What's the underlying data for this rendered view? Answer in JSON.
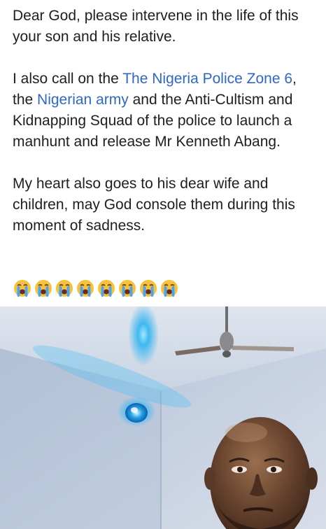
{
  "post": {
    "p1": "Dear God, please intervene in the life of this your son and his relative.",
    "p2_prefix": "I also call on the ",
    "p2_link1": "The Nigeria Police Zone 6",
    "p2_mid1": ", the ",
    "p2_link2": "Nigerian army",
    "p2_suffix": " and the Anti-Cultism and Kidnapping Squad of the police to launch a manhunt and release Mr Kenneth Abang.",
    "p3": "My heart also goes to his dear wife and children, may God console them during this moment of sadness."
  },
  "emojis": {
    "icon": "loudly-crying-face-icon",
    "count": 8
  },
  "colors": {
    "text": "#1c1e21",
    "link": "#2f67c9",
    "emoji_face": "#f7c23a",
    "tears": "#4aa4f2"
  }
}
